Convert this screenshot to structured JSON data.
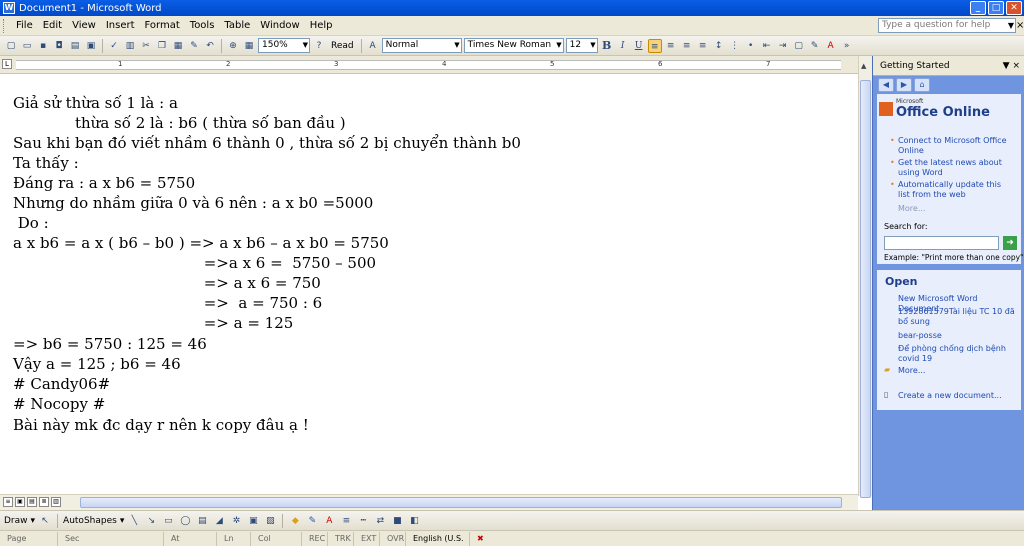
{
  "window": {
    "title": "Document1 - Microsoft Word",
    "buttons": [
      "_",
      "□",
      "✕"
    ]
  },
  "menubar": {
    "items": [
      "File",
      "Edit",
      "View",
      "Insert",
      "Format",
      "Tools",
      "Table",
      "Window",
      "Help"
    ],
    "help_placeholder": "Type a question for help"
  },
  "toolbar": {
    "zoom": "150%",
    "read_label": "Read",
    "style": "Normal",
    "font": "Times New Roman",
    "size": "12",
    "bold": "B",
    "italic": "I",
    "underline": "U"
  },
  "ruler": {
    "numbers": [
      "1",
      "2",
      "3",
      "4",
      "5",
      "6",
      "7"
    ]
  },
  "document": {
    "lines": [
      "Giả sử thừa số 1 là : a",
      "             thừa số 2 là : b6 ( thừa số ban đầu )",
      "Sau khi bạn đó viết nhầm 6 thành 0 , thừa số 2 bị chuyển thành b0",
      "Ta thấy :",
      "Đáng ra : a x b6 = 5750",
      "Nhưng do nhầm giữa 0 và 6 nên : a x b0 =5000",
      " Do :",
      "a x b6 = a x ( b6 – b0 ) => a x b6 – a x b0 = 5750",
      "                                        =>a x 6 =  5750 – 500",
      "                                        => a x 6 = 750",
      "                                        =>  a = 750 : 6",
      "                                        => a = 125",
      "=> b6 = 5750 : 125 = 46",
      "Vậy a = 125 ; b6 = 46",
      "# Candy06#",
      "# Nocopy #",
      "Bài này mk đc dạy r nên k copy đâu ạ !"
    ]
  },
  "taskpane": {
    "title": "Getting Started",
    "logo_small": "Microsoft",
    "logo": "Office Online",
    "links": [
      "Connect to Microsoft Office Online",
      "Get the latest news about using Word",
      "Automatically update this list from the web"
    ],
    "more": "More...",
    "search_label": "Search for:",
    "example": "Example:  \"Print more than one copy\"",
    "open_title": "Open",
    "recent": [
      "New Microsoft Word Document",
      "1392861579Tài liệu TC 10 đã bổ sung",
      "bear-posse",
      "Để phòng chống dịch bệnh covid 19"
    ],
    "open_more": "More...",
    "create": "Create a new document..."
  },
  "drawbar": {
    "draw": "Draw",
    "autoshapes": "AutoShapes"
  },
  "statusbar": {
    "cells": [
      "Page",
      "Sec",
      "At",
      "Ln",
      "Col",
      "REC",
      "TRK",
      "EXT",
      "OVR",
      "English (U.S."
    ]
  }
}
